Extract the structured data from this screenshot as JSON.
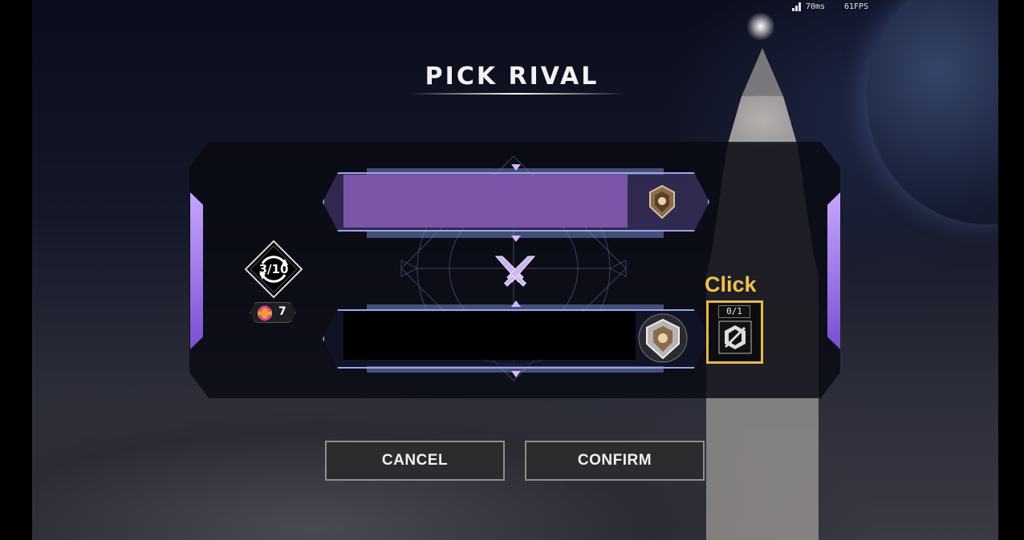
{
  "hud": {
    "ping": "70ms",
    "fps": "61FPS"
  },
  "dialog": {
    "title": "PICK RIVAL"
  },
  "refresh": {
    "count_label": "3/10",
    "currency_amount": "7"
  },
  "item": {
    "hint_label": "Click",
    "counter": "0/1"
  },
  "buttons": {
    "cancel_label": "CANCEL",
    "confirm_label": "CONFIRM"
  },
  "colors": {
    "accent_purple": "#7a55a8",
    "frame_blue": "#9aa6e8",
    "highlight_gold": "#e7b84a"
  },
  "icons": {
    "signal": "signal-bars-icon",
    "rank_top": "rank-badge-icon",
    "rank_bottom": "rank-badge-icon",
    "versus": "crossed-swords-icon",
    "refresh": "refresh-icon",
    "currency": "refresh-token-icon",
    "item": "hidden-rival-item-icon"
  }
}
